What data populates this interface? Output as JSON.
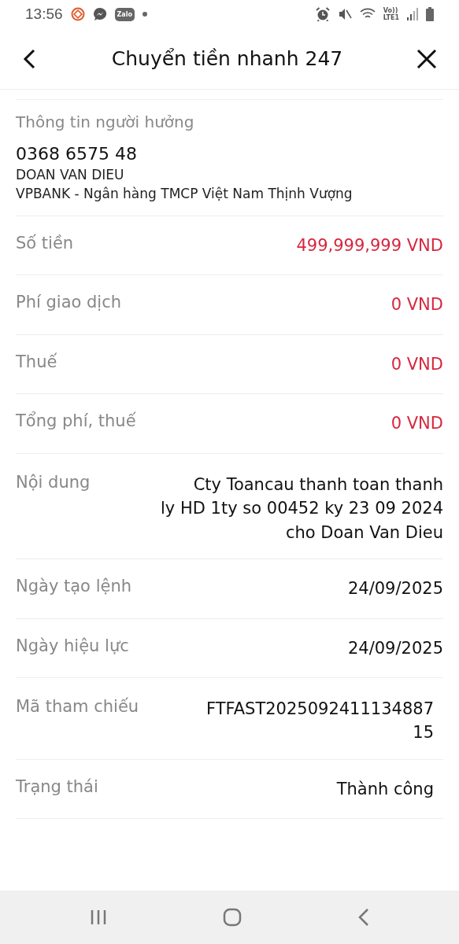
{
  "status_bar": {
    "time": "13:56",
    "app_badge": "Zalo",
    "network_label_top": "Vo))",
    "network_label_bottom": "LTE1"
  },
  "header": {
    "title": "Chuyển tiền nhanh 247"
  },
  "beneficiary": {
    "heading": "Thông tin người hưởng",
    "account": "0368 6575 48",
    "name": "DOAN VAN DIEU",
    "bank": "VPBANK - Ngân hàng TMCP Việt Nam Thịnh Vượng"
  },
  "rows": [
    {
      "label": "Số tiền",
      "value": [
        "499,999,999 VND"
      ],
      "kind": "amount"
    },
    {
      "label": "Phí giao dịch",
      "value": [
        "0 VND"
      ],
      "kind": "amount"
    },
    {
      "label": "Thuế",
      "value": [
        "0 VND"
      ],
      "kind": "amount"
    },
    {
      "label": "Tổng phí, thuế",
      "value": [
        "0 VND"
      ],
      "kind": "amount"
    },
    {
      "label": "Nội dung",
      "value": [
        "Cty Toancau thanh toan thanh",
        "ly HD 1ty so 00452 ky 23 09 2024",
        "cho Doan Van Dieu"
      ],
      "kind": "text"
    },
    {
      "label": "Ngày tạo lệnh",
      "value": [
        "24/09/2025"
      ],
      "kind": "text"
    },
    {
      "label": "Ngày hiệu lực",
      "value": [
        "24/09/2025"
      ],
      "kind": "text"
    },
    {
      "label": "Mã tham chiếu",
      "value": [
        "FTFAST2025092411134887",
        "15"
      ],
      "kind": "code"
    },
    {
      "label": "Trạng thái",
      "value": [
        "Thành công"
      ],
      "kind": "status"
    }
  ]
}
